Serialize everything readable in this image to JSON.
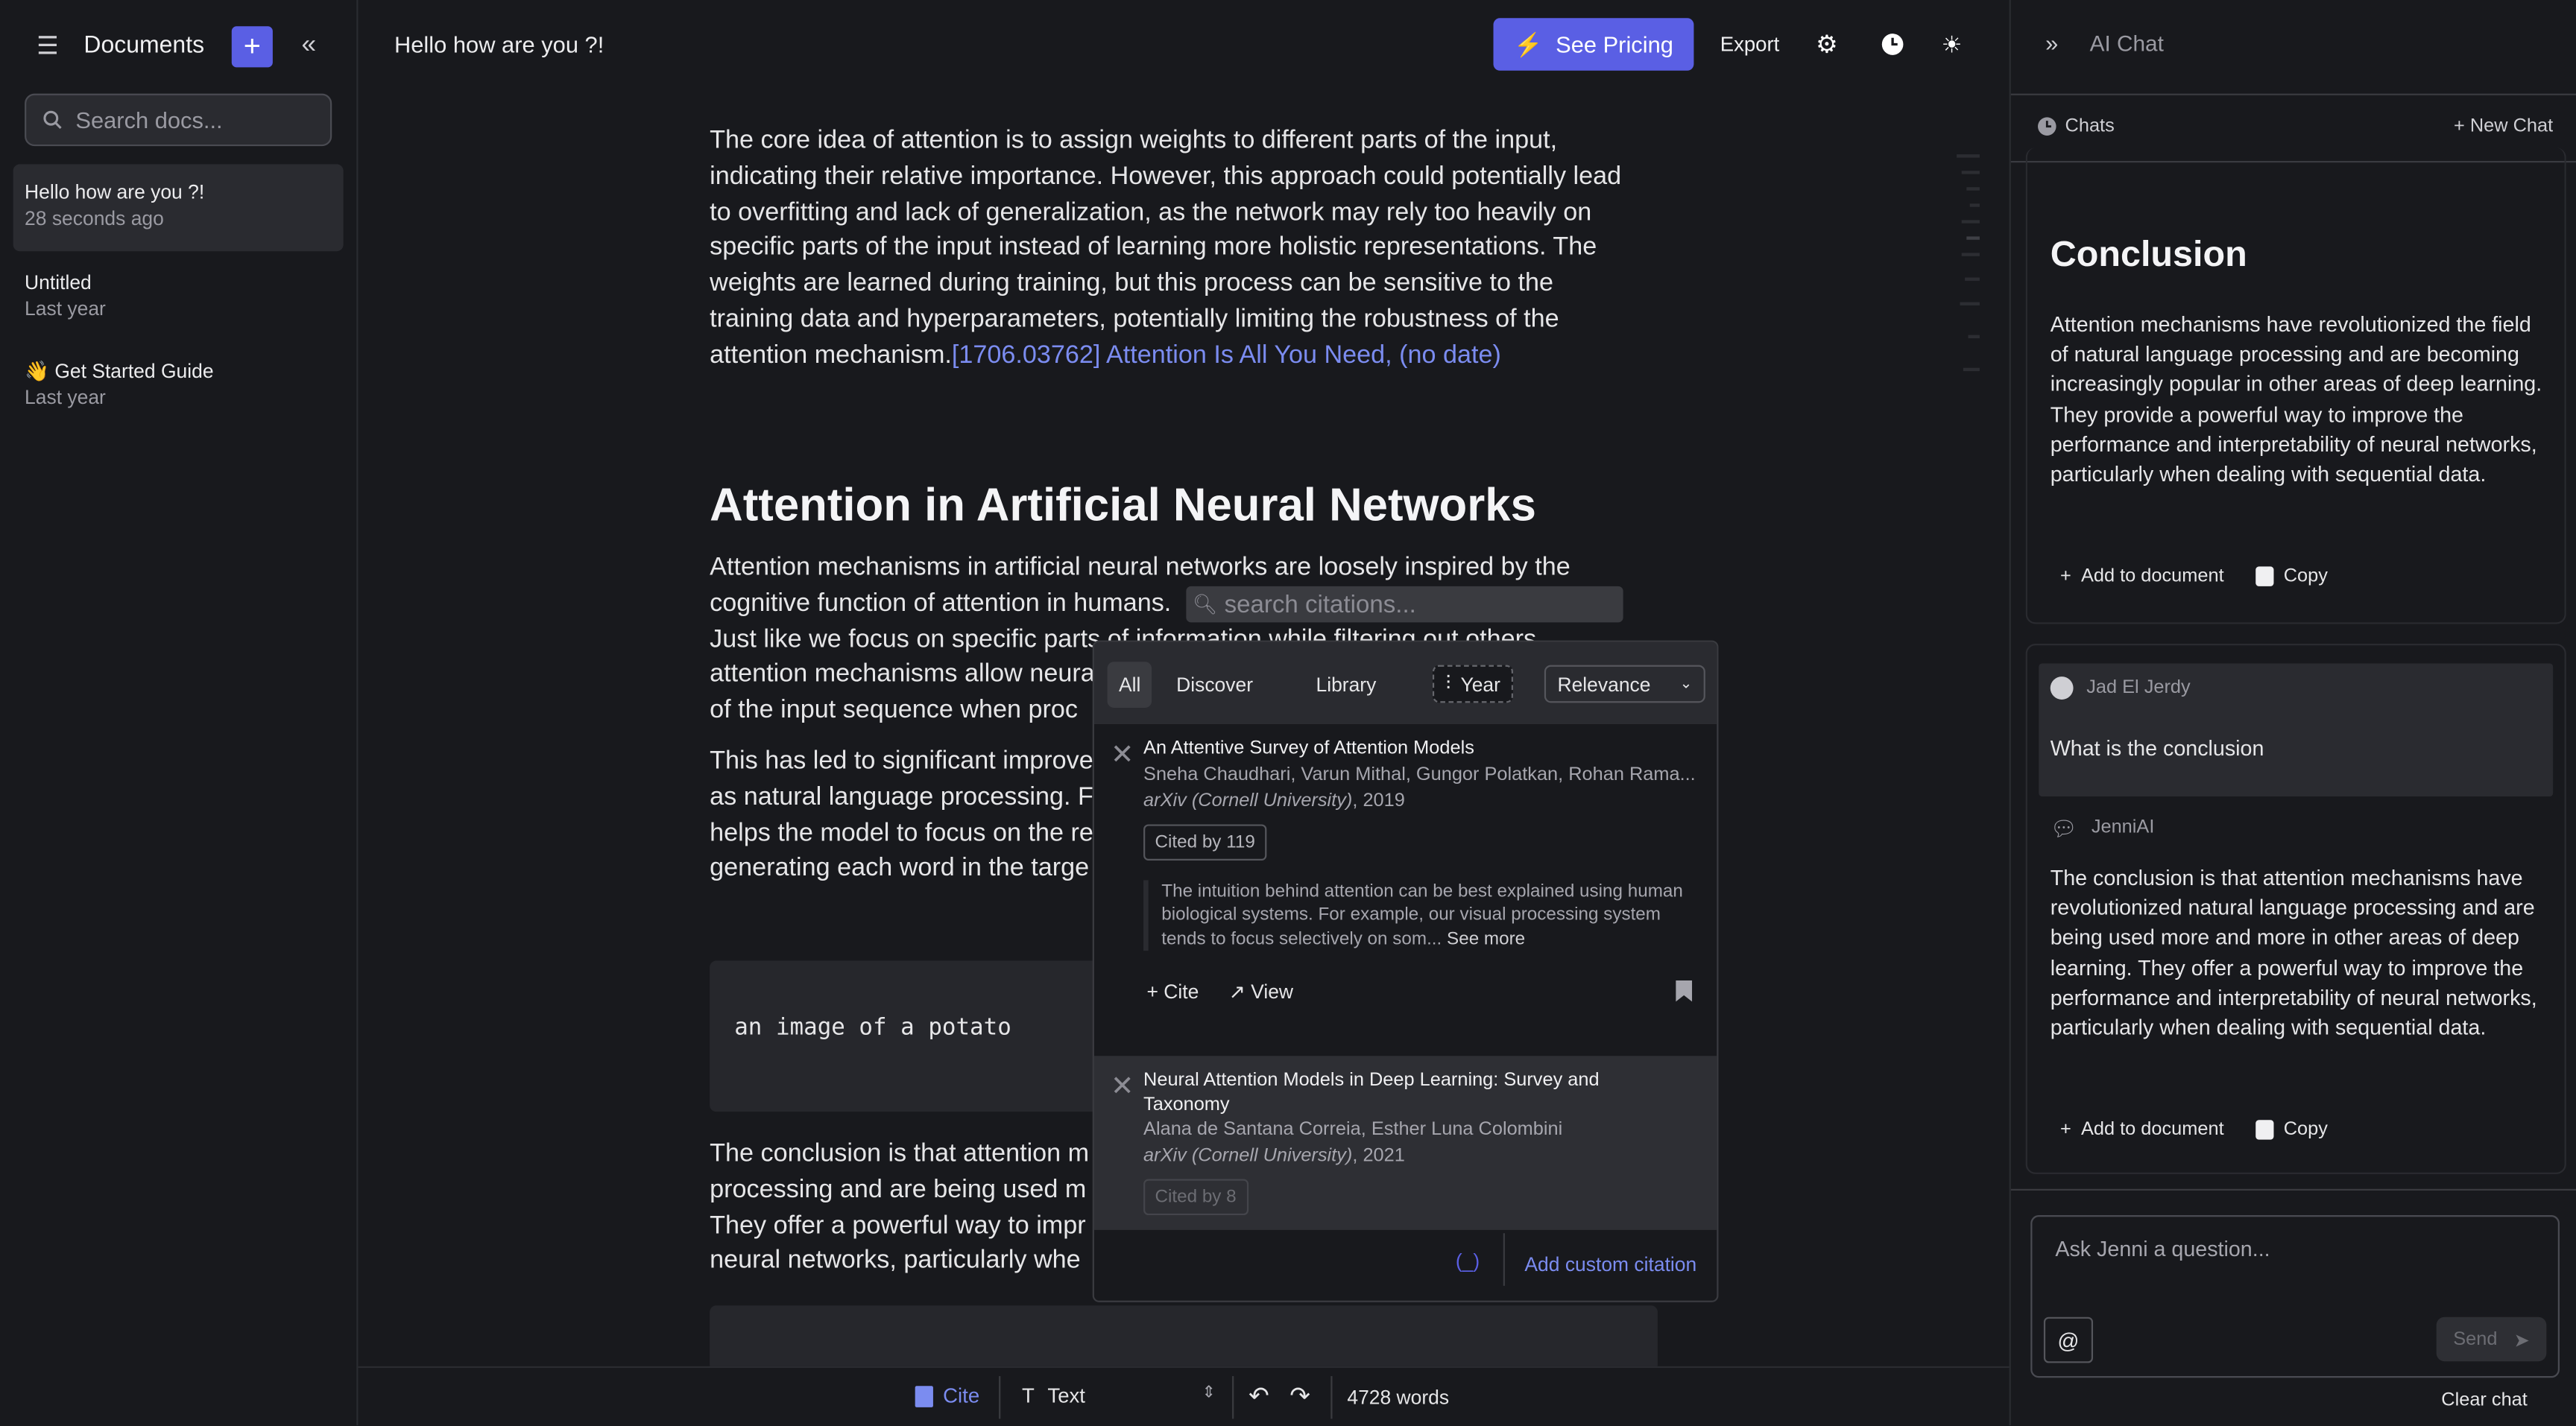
{
  "sidebar": {
    "title": "Documents",
    "search_placeholder": "Search docs...",
    "docs": [
      {
        "title": "Hello how are you ?!",
        "time": "28 seconds ago",
        "selected": true
      },
      {
        "title": "Untitled",
        "time": "Last year"
      },
      {
        "title": "👋 Get Started Guide",
        "time": "Last year"
      }
    ]
  },
  "header": {
    "doc_title": "Hello how are you ?!",
    "pricing_label": "See Pricing",
    "export_label": "Export"
  },
  "editor": {
    "p1": [
      "The core idea of attention is to assign weights to different parts of the input,",
      "indicating their relative importance. However, this approach could potentially lead",
      "to overfitting and lack of generalization, as the network may rely too heavily on",
      "specific parts of the input instead of learning more holistic representations. The",
      "weights are learned during training, but this process can be sensitive to the",
      "training data and hyperparameters, potentially limiting the robustness of the",
      "attention mechanism."
    ],
    "p1_citation": "[1706.03762] Attention Is All You Need, (no date)",
    "heading": "Attention in Artificial Neural Networks",
    "p2": [
      "Attention mechanisms in artificial neural networks are loosely inspired by the",
      "cognitive function of attention in humans.",
      "Just like we focus on specific parts of information while filtering out others,",
      "attention mechanisms allow neura",
      "of the input sequence when proc"
    ],
    "p3": [
      "This has led to significant improve",
      "as natural language processing. F",
      "helps the model to focus on the re",
      "generating each word in the targe"
    ],
    "code1": "an image of a potato",
    "p4": [
      "The conclusion is that attention m",
      "processing and are being used m",
      "They offer a powerful way to impr",
      "neural networks, particularly whe"
    ]
  },
  "citation_popup": {
    "search_placeholder": "search citations...",
    "tabs": [
      "All",
      "Discover",
      "Library"
    ],
    "active_tab": "All",
    "year_filter": "Year",
    "sort": "Relevance",
    "results": [
      {
        "title": "An Attentive Survey of Attention Models",
        "authors": "Sneha Chaudhari, Varun Mithal, Gungor Polatkan, Rohan Rama...",
        "venue": "arXiv (Cornell University)",
        "year": ", 2019",
        "cited": "Cited by 119",
        "abstract": "The intuition behind attention can be best explained using human biological systems. For example, our visual processing system tends to focus selectively on som...",
        "see_more": "See more",
        "cite": "Cite",
        "view": "View"
      },
      {
        "title": "Neural Attention Models in Deep Learning: Survey and Taxonomy",
        "authors": "Alana de Santana Correia, Esther Luna Colombini",
        "venue": "arXiv (Cornell University)",
        "year": ", 2021",
        "cited": "Cited by 8"
      }
    ],
    "add_custom": "Add custom citation"
  },
  "bottombar": {
    "cite": "Cite",
    "block_type": "Text",
    "word_count": "4728 words"
  },
  "ai_chat": {
    "title": "AI Chat",
    "chats_label": "Chats",
    "new_chat": "New Chat",
    "card1": {
      "heading": "Conclusion",
      "text": "Attention mechanisms have revolutionized the field of natural language processing and are becoming increasingly popular in other areas of deep learning. They provide a powerful way to improve the performance and interpretability of neural networks, particularly when dealing with sequential data.",
      "add": "Add to document",
      "copy": "Copy"
    },
    "user": {
      "name": "Jad El Jerdy",
      "message": "What is the conclusion"
    },
    "bot": {
      "name": "JenniAI",
      "message": "The conclusion is that attention mechanisms have revolutionized natural language processing and are being used more and more in other areas of deep learning. They offer a powerful way to improve the performance and interpretability of neural networks, particularly when dealing with sequential data.",
      "add": "Add to document",
      "copy": "Copy"
    },
    "input_placeholder": "Ask Jenni a question...",
    "send": "Send",
    "clear": "Clear chat"
  },
  "colors": {
    "accent": "#5a5fe4",
    "link": "#7b8cf0",
    "background": "#18191d"
  }
}
